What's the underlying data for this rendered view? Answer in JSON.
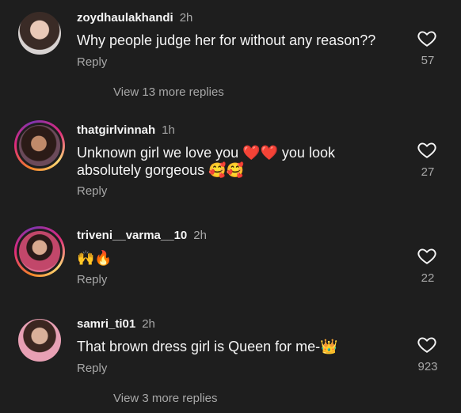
{
  "comments": [
    {
      "username": "zoydhaulakhandi",
      "time": "2h",
      "text": "Why people judge her for without any reason??",
      "reply_label": "Reply",
      "likes": "57",
      "view_replies": "View 13 more replies"
    },
    {
      "username": "thatgirlvinnah",
      "time": "1h",
      "text_line1": "Unknown girl we love you ❤️❤️ you look",
      "text_line2": "absolutely gorgeous 🥰🥰",
      "reply_label": "Reply",
      "likes": "27"
    },
    {
      "username": "triveni__varma__10",
      "time": "2h",
      "text": "🙌🔥",
      "reply_label": "Reply",
      "likes": "22"
    },
    {
      "username": "samri_ti01",
      "time": "2h",
      "text": "That brown dress girl is Queen for me-👑",
      "reply_label": "Reply",
      "likes": "923",
      "view_replies": "View 3 more replies"
    }
  ],
  "icons": {
    "like": "heart-outline-icon"
  },
  "colors": {
    "background": "#1e1e1e",
    "primary_text": "#f5f5f5",
    "secondary_text": "#a8a8a8"
  }
}
